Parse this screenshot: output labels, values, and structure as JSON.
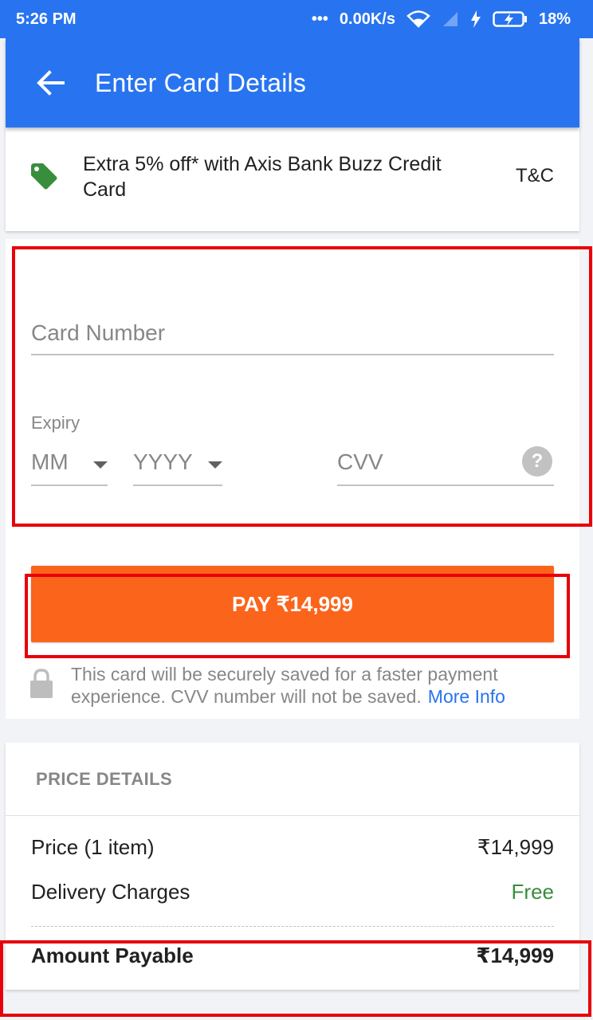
{
  "status_bar": {
    "time": "5:26 PM",
    "dots": "•••",
    "speed": "0.00K/s",
    "battery": "18%",
    "icons": [
      "wifi-icon",
      "signal-icon",
      "charging-icon",
      "battery-icon"
    ]
  },
  "header": {
    "title": "Enter Card Details",
    "back_icon": "arrow-back-icon"
  },
  "offer": {
    "text": "Extra 5% off* with Axis Bank Buzz Credit Card",
    "tnc": "T&C",
    "icon": "tag-icon",
    "icon_color": "#388e3c"
  },
  "card_form": {
    "card_number_placeholder": "Card Number",
    "expiry_label": "Expiry",
    "month_value": "MM",
    "year_value": "YYYY",
    "cvv_placeholder": "CVV",
    "cvv_help": "?"
  },
  "pay": {
    "label": "PAY ₹14,999",
    "color": "#fb641b"
  },
  "secure_note": {
    "text": "This card will be securely saved for a faster payment experience. CVV number will not be saved.",
    "link": "More Info"
  },
  "price_details": {
    "title": "PRICE DETAILS",
    "rows": [
      {
        "label": "Price (1 item)",
        "value": "₹14,999"
      },
      {
        "label": "Delivery Charges",
        "value": "Free"
      }
    ],
    "total_label": "Amount Payable",
    "total_value": "₹14,999"
  },
  "colors": {
    "primary": "#2874f0",
    "accent": "#fb641b",
    "free": "#388e3c",
    "highlight": "#e8000b"
  }
}
